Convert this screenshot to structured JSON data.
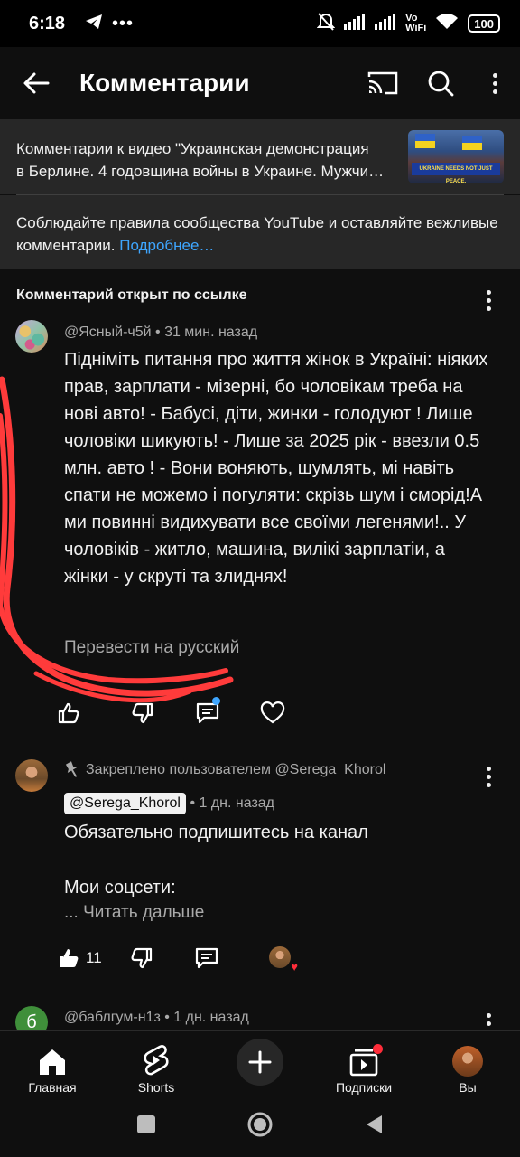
{
  "status_bar": {
    "time": "6:18",
    "battery": "100",
    "wifi_label_top": "Vo",
    "wifi_label_bottom": "WiFi"
  },
  "app_bar": {
    "title": "Комментарии"
  },
  "video_info": {
    "line1": "Комментарии к видео \"Украинская демонстрация",
    "line2": "в Берлине. 4 годовщина войны в Украине. Мужчи…",
    "thumb_banner": "UKRAINE NEEDS NOT JUST PEACE."
  },
  "rules": {
    "text": "Соблюдайте правила сообщества YouTube и оставляйте вежливые комментарии.",
    "more": "Подробнее…"
  },
  "linked_header": "Комментарий открыт по ссылке",
  "comment1": {
    "meta": "@Ясный-ч5й • 31 мин. назад",
    "text": "Підніміть питання про життя жінок в Україні: ніяких прав, зарплати - мізерні, бо чоловікам треба на нові авто! - Бабусі, діти, жинки - голодуют ! Лише чоловіки шикують! - Лише за 2025 рік - ввезли 0.5 млн. авто ! - Вони воняють, шумлять, мі навіть спати не можемо і погуляти: скрізь шум і сморід!А ми повинні видихувати все своїми легенями!.. У чоловіків - житло, машина, вилікі зарплатіи, а жінки - у скруті та злиднях!",
    "translate": "Перевести на русский"
  },
  "comment2": {
    "pinned_label": "Закреплено пользователем @Serega_Khorol",
    "handle": "@Serega_Khorol",
    "time": "• 1 дн. назад",
    "line1": "Обязательно подпишитесь на канал",
    "line2": "Мои соцсети:",
    "read_more": "... Читать дальше",
    "likes": "11"
  },
  "comment3": {
    "avatar_letter": "б",
    "meta": "@баблгум-н1з • 1 дн. назад"
  },
  "bottom_nav": {
    "home": "Главная",
    "shorts": "Shorts",
    "subscriptions": "Подписки",
    "you": "Вы"
  },
  "colors": {
    "background": "#0f0f0f",
    "surface": "#272727",
    "link": "#3ea6ff",
    "annotation": "#ff3b3b"
  }
}
